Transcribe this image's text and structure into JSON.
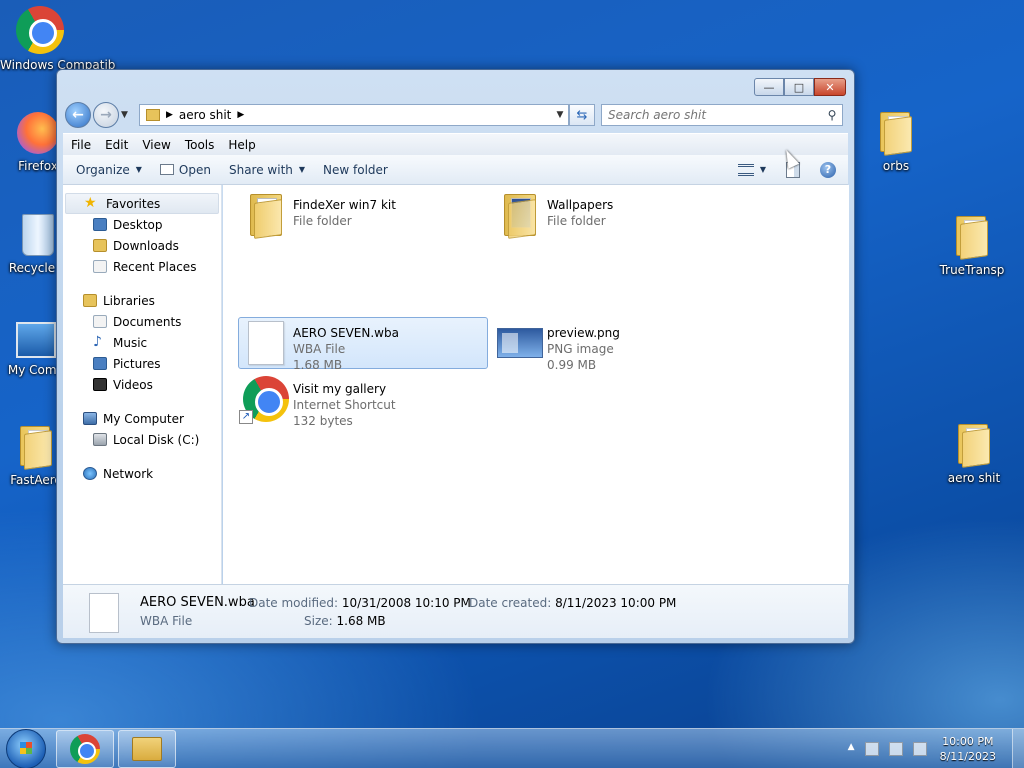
{
  "desktop": {
    "icons": [
      {
        "label": "Windows Compatib",
        "kind": "chrome"
      },
      {
        "label": "Firefox",
        "kind": "firefox"
      },
      {
        "label": "Recycle B",
        "kind": "recycle"
      },
      {
        "label": "My Comp",
        "kind": "computer"
      },
      {
        "label": "FastAero",
        "kind": "folder"
      },
      {
        "label": "orbs",
        "kind": "folder"
      },
      {
        "label": "TrueTransp",
        "kind": "folder"
      },
      {
        "label": "aero shit",
        "kind": "folder"
      }
    ]
  },
  "window": {
    "caption_buttons": {
      "minimize": "—",
      "maximize": "□",
      "close": "✕"
    },
    "address": {
      "path": "aero shit"
    },
    "search": {
      "placeholder": "Search aero shit"
    },
    "menu": [
      "File",
      "Edit",
      "View",
      "Tools",
      "Help"
    ],
    "commands": {
      "organize": "Organize",
      "open": "Open",
      "share_with": "Share with",
      "new_folder": "New folder"
    },
    "nav": {
      "favorites": "Favorites",
      "favorites_items": [
        "Desktop",
        "Downloads",
        "Recent Places"
      ],
      "libraries": "Libraries",
      "libraries_items": [
        "Documents",
        "Music",
        "Pictures",
        "Videos"
      ],
      "computer": "My Computer",
      "computer_items": [
        "Local Disk (C:)"
      ],
      "network": "Network"
    },
    "files": [
      {
        "name": "FindeXer win7 kit",
        "type": "File folder",
        "size": ""
      },
      {
        "name": "Wallpapers",
        "type": "File folder",
        "size": ""
      },
      {
        "name": "AERO SEVEN.wba",
        "type": "WBA File",
        "size": "1.68 MB"
      },
      {
        "name": "preview.png",
        "type": "PNG image",
        "size": "0.99 MB"
      },
      {
        "name": "Visit my gallery",
        "type": "Internet Shortcut",
        "size": "132 bytes"
      }
    ],
    "details": {
      "name": "AERO SEVEN.wba",
      "type": "WBA File",
      "modified_label": "Date modified:",
      "modified": "10/31/2008 10:10 PM",
      "created_label": "Date created:",
      "created": "8/11/2023 10:00 PM",
      "size_label": "Size:",
      "size": "1.68 MB"
    }
  },
  "taskbar": {
    "time": "10:00 PM",
    "date": "8/11/2023"
  }
}
